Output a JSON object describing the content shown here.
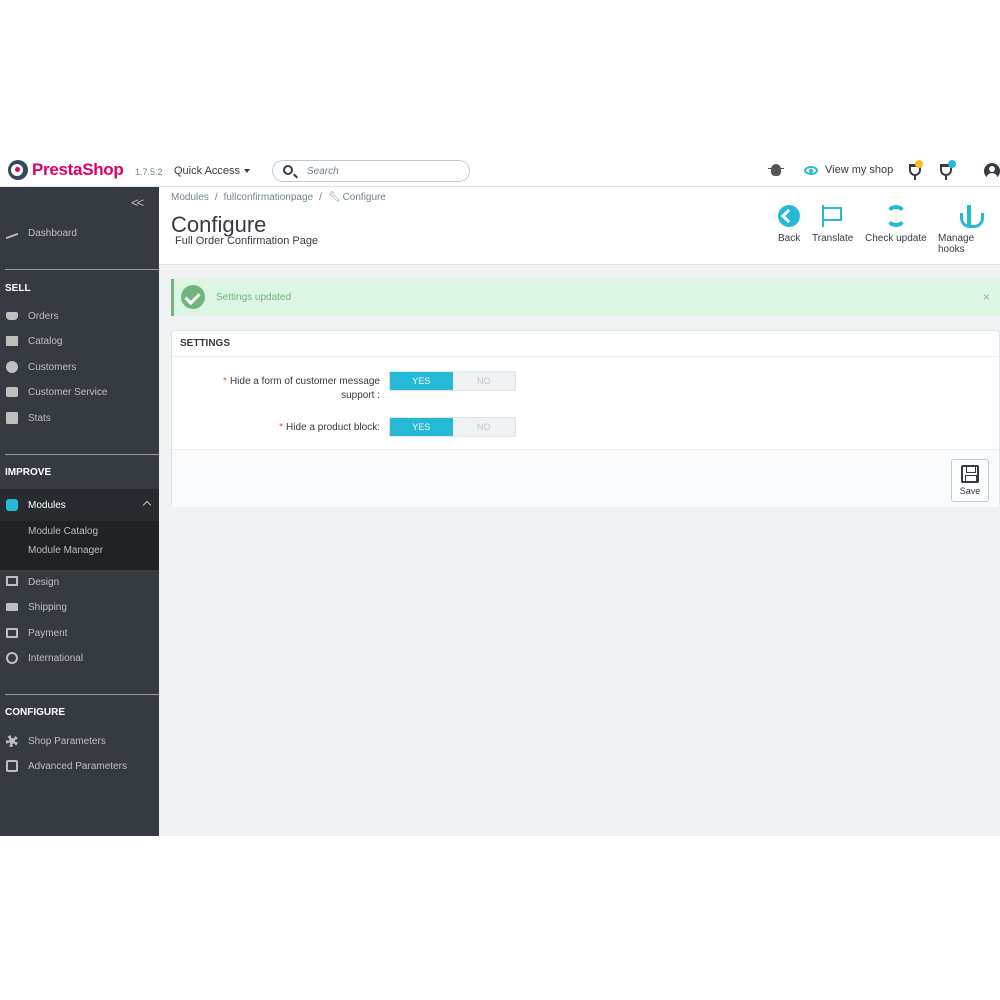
{
  "header": {
    "logo_presta": "Presta",
    "logo_shop": "Shop",
    "version": "1.7.5.2",
    "quick_access": "Quick Access",
    "search_placeholder": "Search",
    "view_my_shop": "View my shop",
    "notification_colors": {
      "orders": "#fbbb22",
      "customers": "#25b9d7"
    }
  },
  "sidebar": {
    "dashboard": "Dashboard",
    "sell_title": "SELL",
    "sell_items": [
      "Orders",
      "Catalog",
      "Customers",
      "Customer Service",
      "Stats"
    ],
    "improve_title": "IMPROVE",
    "modules": "Modules",
    "module_sub": [
      "Module Catalog",
      "Module Manager"
    ],
    "improve_items": [
      "Design",
      "Shipping",
      "Payment",
      "International"
    ],
    "configure_title": "CONFIGURE",
    "configure_items": [
      "Shop Parameters",
      "Advanced Parameters"
    ]
  },
  "breadcrumb": [
    "Modules",
    "fullconfirmationpage",
    "Configure"
  ],
  "page": {
    "title": "Configure",
    "subtitle": "Full Order Confirmation Page"
  },
  "toolbar": {
    "back": "Back",
    "translate": "Translate",
    "check_update": "Check update",
    "manage_hooks": "Manage hooks"
  },
  "alert": {
    "text": "Settings updated",
    "close": "×"
  },
  "settings": {
    "title": "SETTINGS",
    "field1_label_line1": "Hide a form of customer message",
    "field1_label_line2": "support :",
    "field2_label": "Hide a product block:",
    "yes": "YES",
    "no": "NO",
    "save": "Save"
  }
}
